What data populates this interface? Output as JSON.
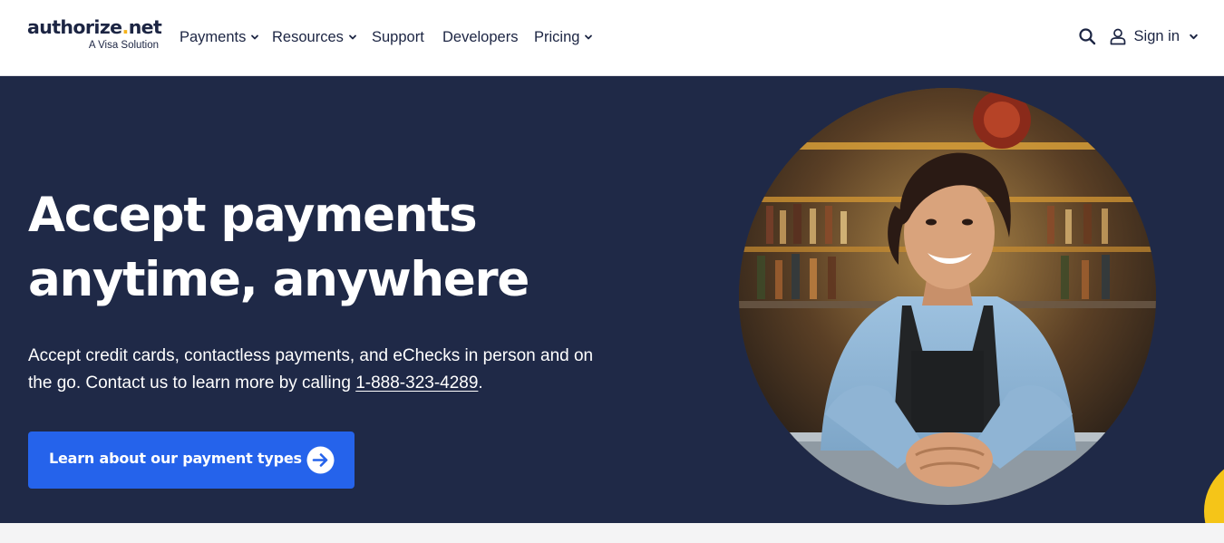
{
  "logo": {
    "brand": "authorize",
    "dot": ".",
    "tld": "net",
    "tagline": "A Visa Solution"
  },
  "nav": {
    "payments": "Payments",
    "resources": "Resources",
    "support": "Support",
    "developers": "Developers",
    "pricing": "Pricing"
  },
  "utility": {
    "sign_in": "Sign in"
  },
  "hero": {
    "title_line1": "Accept payments",
    "title_line2": "anytime, anywhere",
    "description_before": "Accept credit cards, contactless payments, and eChecks in person and on the go. Contact us to learn more by calling ",
    "phone": "1-888-323-4289",
    "description_after": ".",
    "cta_label": "Learn about our payment types"
  },
  "colors": {
    "hero_background": "#1f2947",
    "cta_background": "#2563eb",
    "brand_navy": "#1c2543",
    "logo_dot": "#f5b21a",
    "accent_yellow": "#f5c518"
  },
  "icons": {
    "search": "search-icon",
    "user": "user-icon",
    "chevron": "chevron-down-icon",
    "cta_arrow": "arrow-circle-right-icon"
  }
}
